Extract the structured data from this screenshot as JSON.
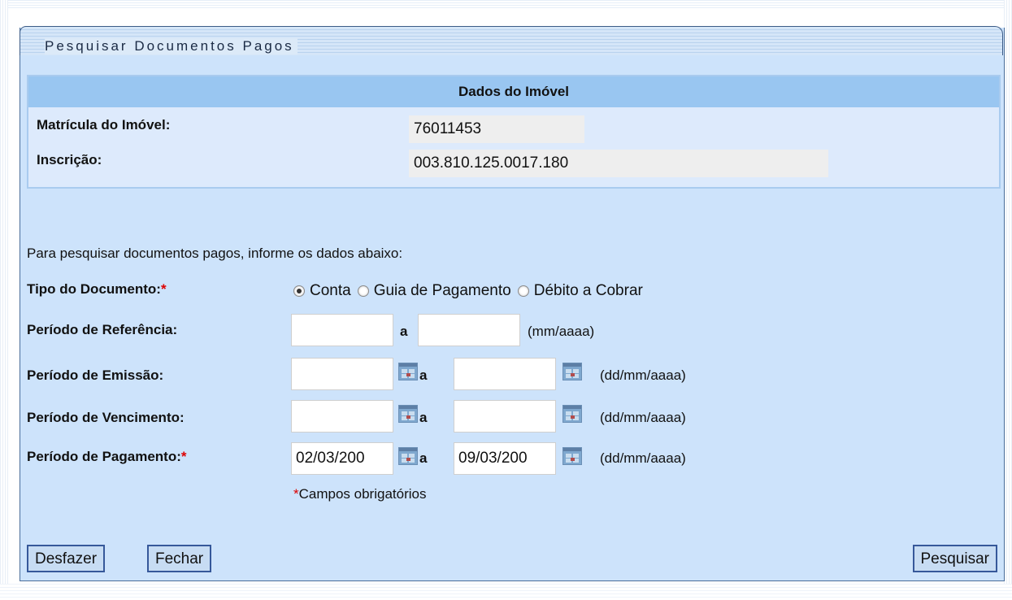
{
  "panel": {
    "title": "Pesquisar Documentos Pagos"
  },
  "imovel": {
    "heading": "Dados do Imóvel",
    "matricula_label": "Matrícula do Imóvel:",
    "matricula_value": "76011453",
    "inscricao_label": "Inscrição:",
    "inscricao_value": "003.810.125.0017.180"
  },
  "form": {
    "intro": "Para pesquisar documentos pagos, informe os dados abaixo:",
    "tipo_label": "Tipo do Documento:",
    "required_mark": "*",
    "tipo_options": [
      "Conta",
      "Guia de Pagamento",
      "Débito a Cobrar"
    ],
    "tipo_selected": "Conta",
    "referencia_label": "Período de Referência:",
    "referencia_from": "",
    "referencia_to": "",
    "referencia_format": "(mm/aaaa)",
    "emissao_label": "Período de Emissão:",
    "emissao_from": "",
    "emissao_to": "",
    "vencimento_label": "Período de Vencimento:",
    "vencimento_from": "",
    "vencimento_to": "",
    "pagamento_label": "Período de Pagamento:",
    "pagamento_from": "02/03/200",
    "pagamento_to": "09/03/200",
    "date_format": "(dd/mm/aaaa)",
    "range_sep": "a",
    "required_note": "Campos obrigatórios"
  },
  "buttons": {
    "desfazer": "Desfazer",
    "fechar": "Fechar",
    "pesquisar": "Pesquisar"
  },
  "colors": {
    "panel_bg": "#cde3fb",
    "section_header": "#99c6f1",
    "required": "#dd0000",
    "button_border": "#36589a"
  },
  "icons": [
    "calendar-icon",
    "radio-checked",
    "radio-unchecked"
  ]
}
